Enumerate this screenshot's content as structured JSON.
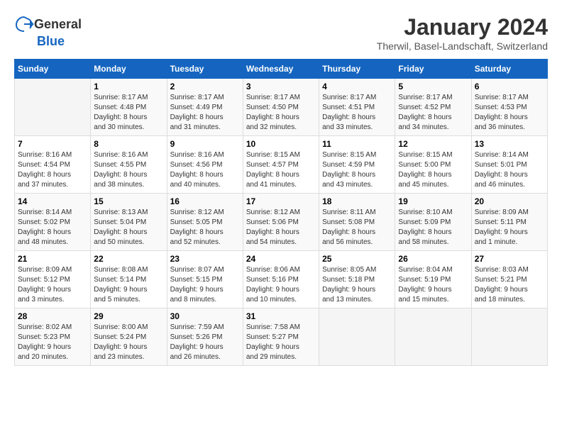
{
  "header": {
    "logo_general": "General",
    "logo_blue": "Blue",
    "title": "January 2024",
    "subtitle": "Therwil, Basel-Landschaft, Switzerland"
  },
  "calendar": {
    "weekdays": [
      "Sunday",
      "Monday",
      "Tuesday",
      "Wednesday",
      "Thursday",
      "Friday",
      "Saturday"
    ],
    "weeks": [
      [
        {
          "day": "",
          "info": ""
        },
        {
          "day": "1",
          "info": "Sunrise: 8:17 AM\nSunset: 4:48 PM\nDaylight: 8 hours\nand 30 minutes."
        },
        {
          "day": "2",
          "info": "Sunrise: 8:17 AM\nSunset: 4:49 PM\nDaylight: 8 hours\nand 31 minutes."
        },
        {
          "day": "3",
          "info": "Sunrise: 8:17 AM\nSunset: 4:50 PM\nDaylight: 8 hours\nand 32 minutes."
        },
        {
          "day": "4",
          "info": "Sunrise: 8:17 AM\nSunset: 4:51 PM\nDaylight: 8 hours\nand 33 minutes."
        },
        {
          "day": "5",
          "info": "Sunrise: 8:17 AM\nSunset: 4:52 PM\nDaylight: 8 hours\nand 34 minutes."
        },
        {
          "day": "6",
          "info": "Sunrise: 8:17 AM\nSunset: 4:53 PM\nDaylight: 8 hours\nand 36 minutes."
        }
      ],
      [
        {
          "day": "7",
          "info": "Sunrise: 8:16 AM\nSunset: 4:54 PM\nDaylight: 8 hours\nand 37 minutes."
        },
        {
          "day": "8",
          "info": "Sunrise: 8:16 AM\nSunset: 4:55 PM\nDaylight: 8 hours\nand 38 minutes."
        },
        {
          "day": "9",
          "info": "Sunrise: 8:16 AM\nSunset: 4:56 PM\nDaylight: 8 hours\nand 40 minutes."
        },
        {
          "day": "10",
          "info": "Sunrise: 8:15 AM\nSunset: 4:57 PM\nDaylight: 8 hours\nand 41 minutes."
        },
        {
          "day": "11",
          "info": "Sunrise: 8:15 AM\nSunset: 4:59 PM\nDaylight: 8 hours\nand 43 minutes."
        },
        {
          "day": "12",
          "info": "Sunrise: 8:15 AM\nSunset: 5:00 PM\nDaylight: 8 hours\nand 45 minutes."
        },
        {
          "day": "13",
          "info": "Sunrise: 8:14 AM\nSunset: 5:01 PM\nDaylight: 8 hours\nand 46 minutes."
        }
      ],
      [
        {
          "day": "14",
          "info": "Sunrise: 8:14 AM\nSunset: 5:02 PM\nDaylight: 8 hours\nand 48 minutes."
        },
        {
          "day": "15",
          "info": "Sunrise: 8:13 AM\nSunset: 5:04 PM\nDaylight: 8 hours\nand 50 minutes."
        },
        {
          "day": "16",
          "info": "Sunrise: 8:12 AM\nSunset: 5:05 PM\nDaylight: 8 hours\nand 52 minutes."
        },
        {
          "day": "17",
          "info": "Sunrise: 8:12 AM\nSunset: 5:06 PM\nDaylight: 8 hours\nand 54 minutes."
        },
        {
          "day": "18",
          "info": "Sunrise: 8:11 AM\nSunset: 5:08 PM\nDaylight: 8 hours\nand 56 minutes."
        },
        {
          "day": "19",
          "info": "Sunrise: 8:10 AM\nSunset: 5:09 PM\nDaylight: 8 hours\nand 58 minutes."
        },
        {
          "day": "20",
          "info": "Sunrise: 8:09 AM\nSunset: 5:11 PM\nDaylight: 9 hours\nand 1 minute."
        }
      ],
      [
        {
          "day": "21",
          "info": "Sunrise: 8:09 AM\nSunset: 5:12 PM\nDaylight: 9 hours\nand 3 minutes."
        },
        {
          "day": "22",
          "info": "Sunrise: 8:08 AM\nSunset: 5:14 PM\nDaylight: 9 hours\nand 5 minutes."
        },
        {
          "day": "23",
          "info": "Sunrise: 8:07 AM\nSunset: 5:15 PM\nDaylight: 9 hours\nand 8 minutes."
        },
        {
          "day": "24",
          "info": "Sunrise: 8:06 AM\nSunset: 5:16 PM\nDaylight: 9 hours\nand 10 minutes."
        },
        {
          "day": "25",
          "info": "Sunrise: 8:05 AM\nSunset: 5:18 PM\nDaylight: 9 hours\nand 13 minutes."
        },
        {
          "day": "26",
          "info": "Sunrise: 8:04 AM\nSunset: 5:19 PM\nDaylight: 9 hours\nand 15 minutes."
        },
        {
          "day": "27",
          "info": "Sunrise: 8:03 AM\nSunset: 5:21 PM\nDaylight: 9 hours\nand 18 minutes."
        }
      ],
      [
        {
          "day": "28",
          "info": "Sunrise: 8:02 AM\nSunset: 5:23 PM\nDaylight: 9 hours\nand 20 minutes."
        },
        {
          "day": "29",
          "info": "Sunrise: 8:00 AM\nSunset: 5:24 PM\nDaylight: 9 hours\nand 23 minutes."
        },
        {
          "day": "30",
          "info": "Sunrise: 7:59 AM\nSunset: 5:26 PM\nDaylight: 9 hours\nand 26 minutes."
        },
        {
          "day": "31",
          "info": "Sunrise: 7:58 AM\nSunset: 5:27 PM\nDaylight: 9 hours\nand 29 minutes."
        },
        {
          "day": "",
          "info": ""
        },
        {
          "day": "",
          "info": ""
        },
        {
          "day": "",
          "info": ""
        }
      ]
    ]
  }
}
